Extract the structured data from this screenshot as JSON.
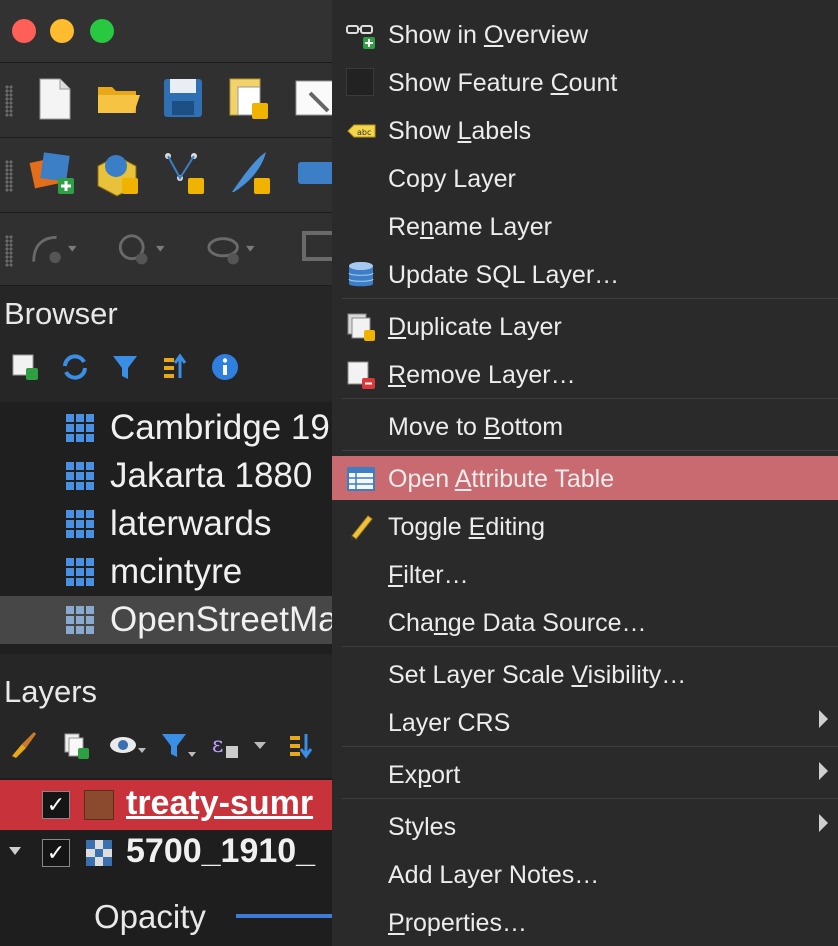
{
  "browser": {
    "title": "Browser",
    "items": [
      {
        "label": "Cambridge 19"
      },
      {
        "label": "Jakarta 1880"
      },
      {
        "label": "laterwards"
      },
      {
        "label": "mcintyre"
      },
      {
        "label": "OpenStreetMa"
      }
    ]
  },
  "layers": {
    "title": "Layers",
    "rows": [
      {
        "label": "treaty-sumr",
        "checked": "✓",
        "color": "#8b4a2e"
      },
      {
        "label": "5700_1910_",
        "checked": "✓"
      }
    ],
    "opacity_label": "Opacity"
  },
  "menu": {
    "items": [
      {
        "pre": "Show in ",
        "u": "O",
        "post": "verview"
      },
      {
        "pre": "Show Feature ",
        "u": "C",
        "post": "ount"
      },
      {
        "pre": "Show ",
        "u": "L",
        "post": "abels"
      },
      {
        "pre": "Copy Layer",
        "u": "",
        "post": ""
      },
      {
        "pre": "Re",
        "u": "n",
        "post": "ame Layer"
      },
      {
        "pre": "Update SQL Layer…",
        "u": "",
        "post": ""
      },
      {
        "pre": "",
        "u": "D",
        "post": "uplicate Layer"
      },
      {
        "pre": "",
        "u": "R",
        "post": "emove Layer…"
      },
      {
        "pre": "Move to ",
        "u": "B",
        "post": "ottom"
      },
      {
        "pre": "Open ",
        "u": "A",
        "post": "ttribute Table"
      },
      {
        "pre": "Toggle ",
        "u": "E",
        "post": "diting"
      },
      {
        "pre": "",
        "u": "F",
        "post": "ilter…"
      },
      {
        "pre": "Cha",
        "u": "n",
        "post": "ge Data Source…"
      },
      {
        "pre": "Set Layer Scale ",
        "u": "V",
        "post": "isibility…"
      },
      {
        "pre": "Layer CRS",
        "u": "",
        "post": ""
      },
      {
        "pre": "Ex",
        "u": "p",
        "post": "ort"
      },
      {
        "pre": "Styles",
        "u": "",
        "post": ""
      },
      {
        "pre": "Add Layer Notes…",
        "u": "",
        "post": ""
      },
      {
        "pre": "",
        "u": "P",
        "post": "roperties…"
      }
    ]
  },
  "colors": {
    "highlight": "#c96a70",
    "selected_layer": "#c8323a"
  }
}
